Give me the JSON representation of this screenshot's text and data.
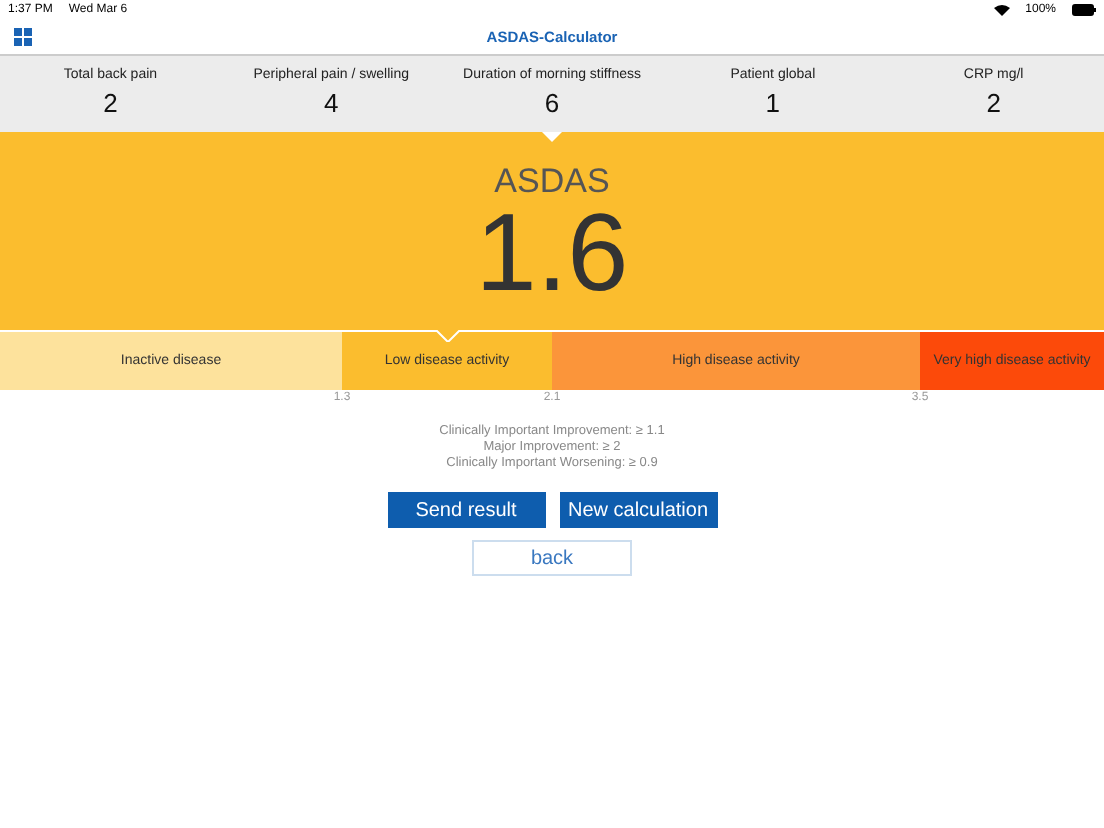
{
  "status_bar": {
    "time": "1:37 PM",
    "date": "Wed Mar 6",
    "battery": "100%"
  },
  "nav": {
    "title": "ASDAS-Calculator"
  },
  "params": [
    {
      "label": "Total back pain",
      "value": "2",
      "selected": false
    },
    {
      "label": "Peripheral pain / swelling",
      "value": "4",
      "selected": false
    },
    {
      "label": "Duration of morning stiffness",
      "value": "6",
      "selected": true
    },
    {
      "label": "Patient global",
      "value": "1",
      "selected": false
    },
    {
      "label": "CRP mg/l",
      "value": "2",
      "selected": false
    }
  ],
  "result": {
    "title": "ASDAS",
    "value": "1.6"
  },
  "scale": [
    {
      "label": "Inactive disease",
      "color": "#fde29c",
      "selected": false
    },
    {
      "label": "Low disease activity",
      "color": "#fbbd2e",
      "selected": true
    },
    {
      "label": "High disease activity",
      "color": "#fb953a",
      "selected": false
    },
    {
      "label": "Very high disease activity",
      "color": "#fc4a0a",
      "selected": false
    }
  ],
  "ticks": [
    "1.3",
    "2.1",
    "3.5"
  ],
  "notes": [
    "Clinically Important Improvement: ≥ 1.1",
    "Major Improvement: ≥ 2",
    "Clinically Important Worsening: ≥ 0.9"
  ],
  "buttons": [
    "Send result",
    "New calculation"
  ],
  "back_button": "back"
}
